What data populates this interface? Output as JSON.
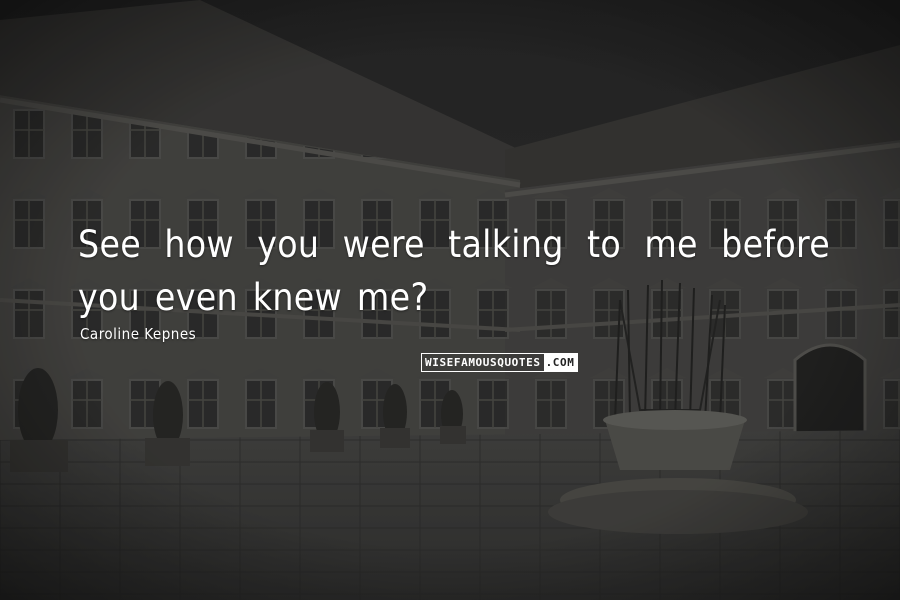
{
  "quote": {
    "text": "See how you were talking to me before you even knew me?",
    "author": "Caroline Kepnes"
  },
  "watermark": {
    "part1": "WISEFAMOUSQUOTES",
    "part2": ".COM"
  },
  "colors": {
    "text": "#ffffff",
    "background": "#3a3a3a"
  }
}
